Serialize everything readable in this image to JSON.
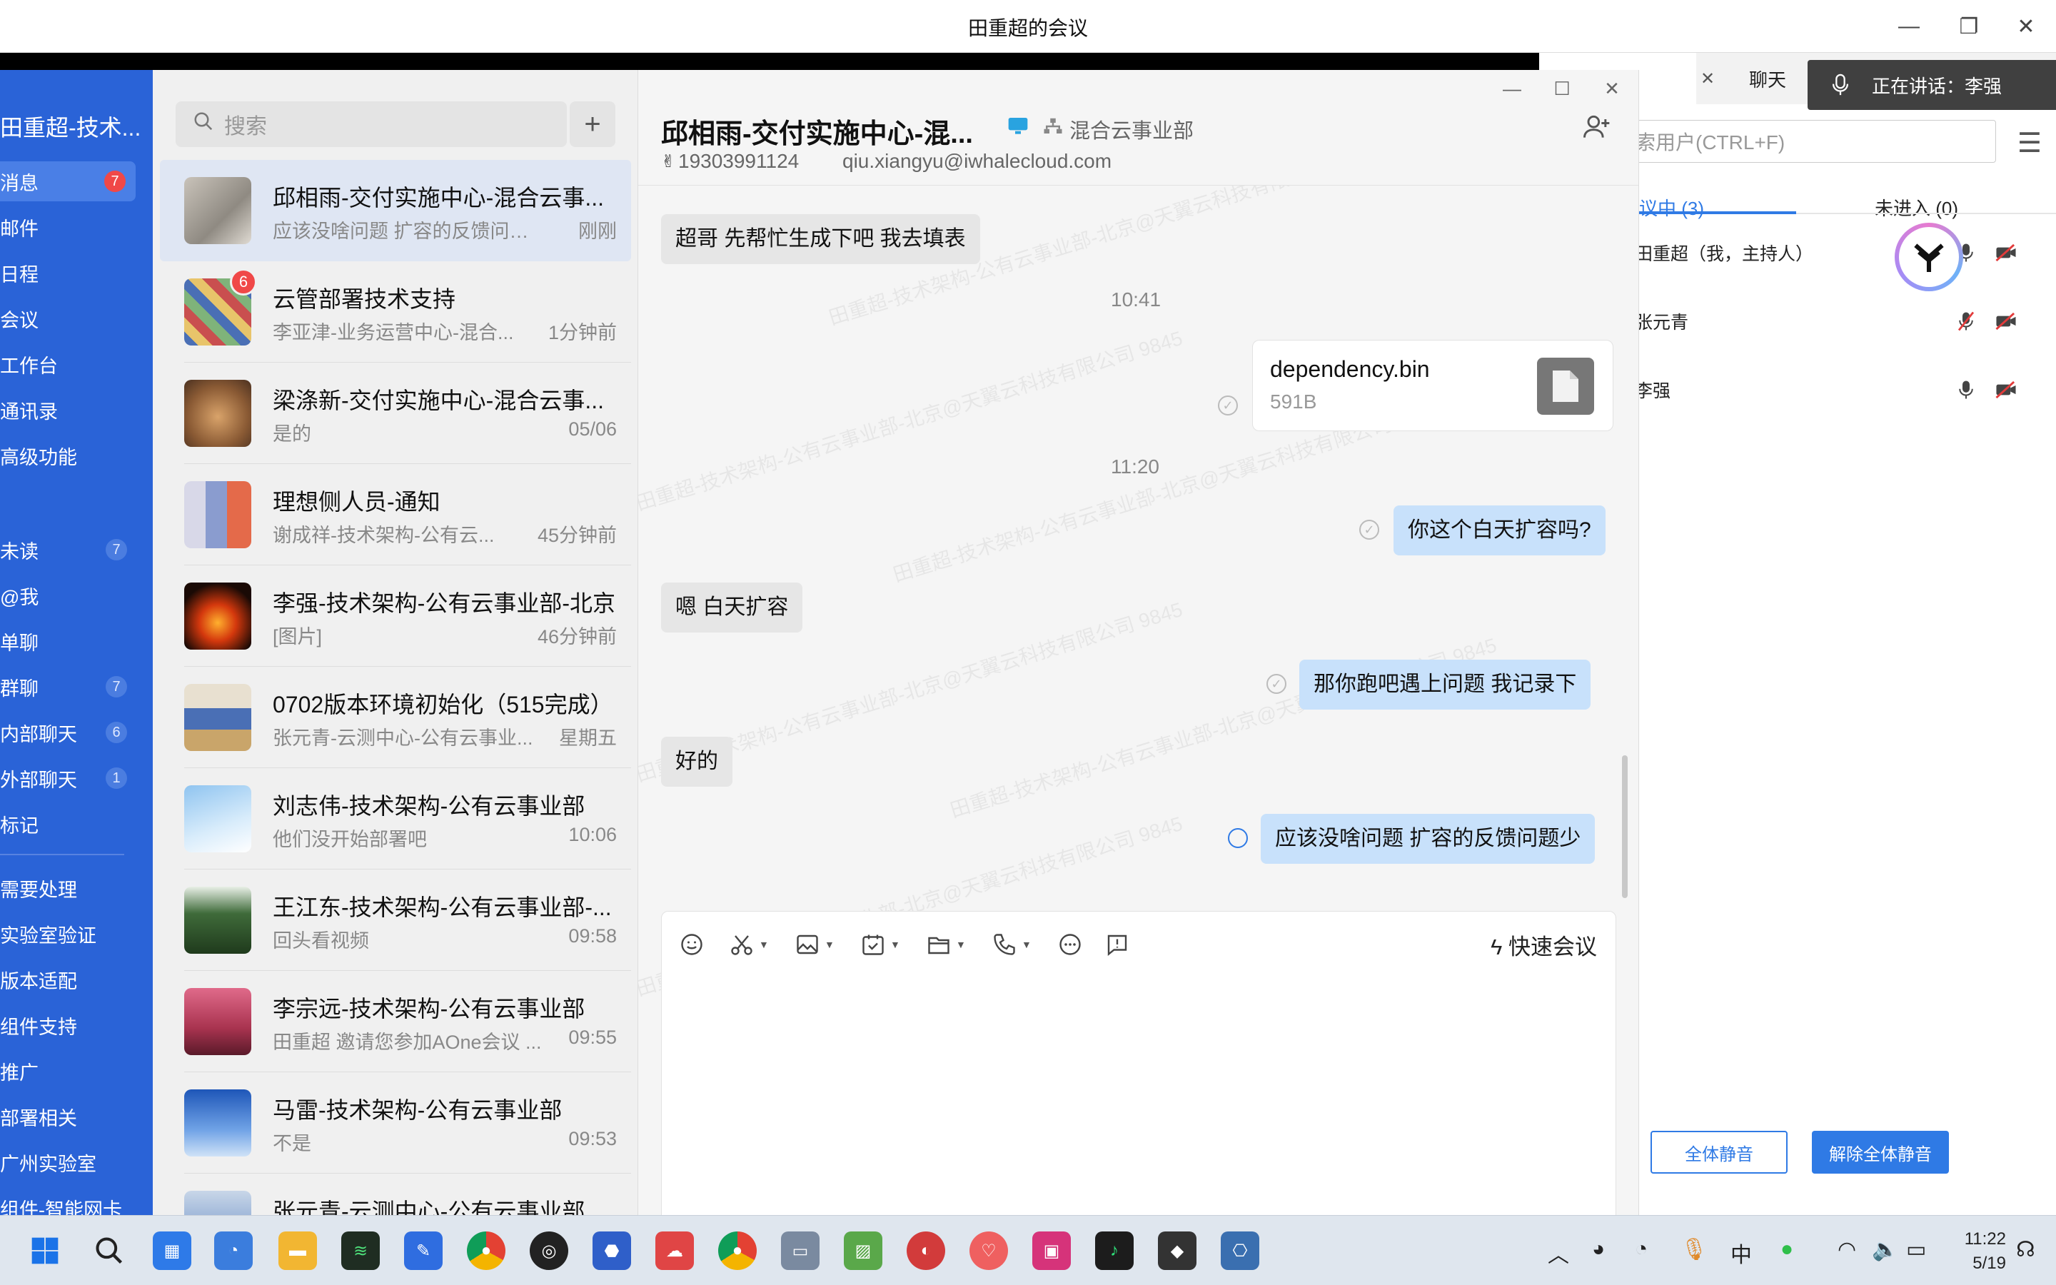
{
  "window": {
    "title": "田重超的会议"
  },
  "leftnav": {
    "account": "田重超-技术...",
    "items": [
      {
        "label": "消息",
        "badge": "7",
        "badge_style": "red"
      },
      {
        "label": "邮件"
      },
      {
        "label": "日程"
      },
      {
        "label": "会议"
      },
      {
        "label": "工作台"
      },
      {
        "label": "通讯录"
      },
      {
        "label": "高级功能"
      }
    ],
    "filters": [
      {
        "label": "未读",
        "badge": "7"
      },
      {
        "label": "@我"
      },
      {
        "label": "单聊"
      },
      {
        "label": "群聊",
        "badge": "7"
      },
      {
        "label": "内部聊天",
        "badge": "6"
      },
      {
        "label": "外部聊天",
        "badge": "1"
      },
      {
        "label": "标记"
      }
    ],
    "groups": [
      {
        "label": "需要处理"
      },
      {
        "label": "实验室验证"
      },
      {
        "label": "版本适配"
      },
      {
        "label": "组件支持"
      },
      {
        "label": "推广"
      },
      {
        "label": "部署相关"
      },
      {
        "label": "广州实验室"
      },
      {
        "label": "组件-智能网卡"
      }
    ]
  },
  "convlist": {
    "search_placeholder": "搜索",
    "add_label": "+",
    "items": [
      {
        "name": "邱相雨-交付实施中心-混合云事...",
        "preview": "应该没啥问题 扩容的反馈问题少",
        "time": "刚刚",
        "selected": true
      },
      {
        "name": "云管部署技术支持",
        "preview": "李亚津-业务运营中心-混合...",
        "time": "1分钟前",
        "badge": "6"
      },
      {
        "name": "梁涤新-交付实施中心-混合云事...",
        "preview": "是的",
        "time": "05/06"
      },
      {
        "name": "理想侧人员-通知",
        "preview": "谢成祥-技术架构-公有云...",
        "time": "45分钟前"
      },
      {
        "name": "李强-技术架构-公有云事业部-北京",
        "preview": "[图片]",
        "time": "46分钟前"
      },
      {
        "name": "0702版本环境初始化（515完成）",
        "preview": "张元青-云测中心-公有云事业...",
        "time": "星期五"
      },
      {
        "name": "刘志伟-技术架构-公有云事业部",
        "preview": "他们没开始部署吧",
        "time": "10:06"
      },
      {
        "name": "王江东-技术架构-公有云事业部-...",
        "preview": "回头看视频",
        "time": "09:58"
      },
      {
        "name": "李宗远-技术架构-公有云事业部",
        "preview": "田重超 邀请您参加AOne会议 ...",
        "time": "09:55"
      },
      {
        "name": "马雷-技术架构-公有云事业部",
        "preview": "不是",
        "time": "09:53"
      },
      {
        "name": "张元青-云测中心-公有云事业部",
        "preview": "",
        "time": ""
      }
    ]
  },
  "chat": {
    "name": "邱相雨-交付实施中心-混...",
    "dept": "混合云事业部",
    "phone": "19303991124",
    "email": "qiu.xiangyu@iwhalecloud.com",
    "watermark": "田重超-技术架构-公有云事业部-北京@天翼云科技有限公司 9845",
    "messages": [
      {
        "side": "left",
        "text": "超哥 先帮忙生成下吧 我去填表"
      },
      {
        "type": "time",
        "text": "10:41"
      },
      {
        "type": "file",
        "filename": "dependency.bin",
        "size": "591B"
      },
      {
        "type": "time",
        "text": "11:20"
      },
      {
        "side": "right",
        "text": "你这个白天扩容吗?"
      },
      {
        "side": "left",
        "text": "嗯 白天扩容"
      },
      {
        "side": "right",
        "text": "那你跑吧遇上问题 我记录下"
      },
      {
        "side": "left",
        "text": "好的"
      },
      {
        "side": "right",
        "text": "应该没啥问题 扩容的反馈问题少"
      }
    ],
    "quick_meeting": "快速会议"
  },
  "meeting": {
    "tab_chat": "聊天",
    "speaking": "正在讲话：李强",
    "search_placeholder": "索用户(CTRL+F)",
    "in_meeting": "议中 (3)",
    "not_joined": "未进入 (0)",
    "participants": [
      {
        "name": "田重超（我，主持人）",
        "mic": "on",
        "cam": "off"
      },
      {
        "name": "张元青",
        "mic": "muted",
        "cam": "off"
      },
      {
        "name": "李强",
        "mic": "on",
        "cam": "off"
      }
    ],
    "mute_all": "全体静音",
    "unmute_all": "解除全体静音"
  },
  "taskbar": {
    "ime": "中",
    "time": "11:22",
    "date": "5/19"
  },
  "colors": {
    "nav_blue": "#2a63d7",
    "accent": "#2f7ae5",
    "bubble_right": "#c8e1fb",
    "badge_red": "#f04848"
  }
}
